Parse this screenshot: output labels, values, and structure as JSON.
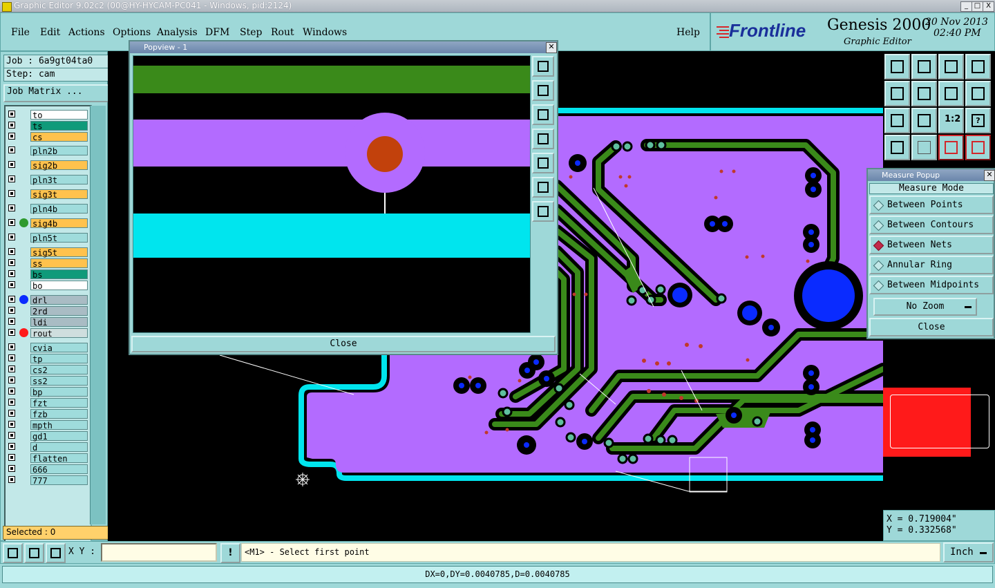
{
  "window": {
    "title": "Graphic Editor 9.02c2 (00@HY-HYCAM-PC041 - Windows, pid:2124)",
    "minimize": "_",
    "maximize": "□",
    "close": "X"
  },
  "menu": {
    "items": [
      "File",
      "Edit",
      "Actions",
      "Options",
      "Analysis",
      "DFM",
      "Step",
      "Rout",
      "Windows"
    ],
    "help": "Help"
  },
  "brand": {
    "logo": "Frontline",
    "product": "Genesis 2000",
    "subtitle": "Graphic Editor",
    "date": "20 Nov 2013",
    "time": "02:40 PM"
  },
  "job": {
    "job_label": "Job : 6a9gt04ta0",
    "step_label": "Step: cam",
    "matrix_button": "Job Matrix ..."
  },
  "layers": [
    {
      "name": "to",
      "color": "#ffffff"
    },
    {
      "name": "ts",
      "color": "#0f9a7a"
    },
    {
      "name": "cs",
      "color": "#ffc24d"
    },
    {
      "name": "pln2b",
      "color": "#9fdcdc"
    },
    {
      "name": "sig2b",
      "color": "#ffc24d"
    },
    {
      "name": "pln3t",
      "color": "#9fdcdc"
    },
    {
      "name": "sig3t",
      "color": "#ffc24d"
    },
    {
      "name": "pln4b",
      "color": "#9fdcdc"
    },
    {
      "name": "sig4b",
      "color": "#ffc24d",
      "dot": "#2e9a2e"
    },
    {
      "name": "pln5t",
      "color": "#9fdcdc"
    },
    {
      "name": "sig5t",
      "color": "#ffc24d"
    },
    {
      "name": "ss",
      "color": "#ffc24d"
    },
    {
      "name": "bs",
      "color": "#0f9a7a"
    },
    {
      "name": "bo",
      "color": "#ffffff"
    },
    {
      "name": "drl",
      "color": "#a9bcc4",
      "dot": "#0a2bff"
    },
    {
      "name": "2rd",
      "color": "#a9bcc4"
    },
    {
      "name": "ldi",
      "color": "#a9bcc4"
    },
    {
      "name": "rout",
      "color": "#cfdede",
      "dot": "#ff1a1a"
    },
    {
      "name": "cvia",
      "color": "#9fdcdc"
    },
    {
      "name": "tp",
      "color": "#9fdcdc"
    },
    {
      "name": "cs2",
      "color": "#9fdcdc"
    },
    {
      "name": "ss2",
      "color": "#9fdcdc"
    },
    {
      "name": "bp",
      "color": "#9fdcdc"
    },
    {
      "name": "fzt",
      "color": "#9fdcdc"
    },
    {
      "name": "fzb",
      "color": "#9fdcdc"
    },
    {
      "name": "mpth",
      "color": "#9fdcdc"
    },
    {
      "name": "gd1",
      "color": "#9fdcdc"
    },
    {
      "name": "d",
      "color": "#9fdcdc"
    },
    {
      "name": "flatten",
      "color": "#9fdcdc"
    },
    {
      "name": "666",
      "color": "#9fdcdc"
    },
    {
      "name": "777",
      "color": "#9fdcdc"
    }
  ],
  "selected_text": "Selected : 0",
  "popview": {
    "title": "Popview - 1",
    "close_label": "Close"
  },
  "measure": {
    "title": "Measure Popup",
    "mode_label": "Measure Mode",
    "options": [
      "Between Points",
      "Between Contours",
      "Between Nets",
      "Annular Ring",
      "Between Midpoints"
    ],
    "selected_option": "Between Nets",
    "zoom_select": "No Zoom",
    "close_label": "Close"
  },
  "coords": {
    "x": "X = 0.719004\"",
    "y": "Y = 0.332568\""
  },
  "command": {
    "xy_label": "X Y :",
    "xy_value": "",
    "prompt": "<M1> - Select first point",
    "units": "Inch"
  },
  "status": "DX=0,DY=0.0040785,D=0.0040785",
  "colors": {
    "panel": "#9ed8d8",
    "board": "#b36bff",
    "trace": "#3a8a1a",
    "outline": "#00e5ee",
    "drill": "#0a2bff"
  }
}
